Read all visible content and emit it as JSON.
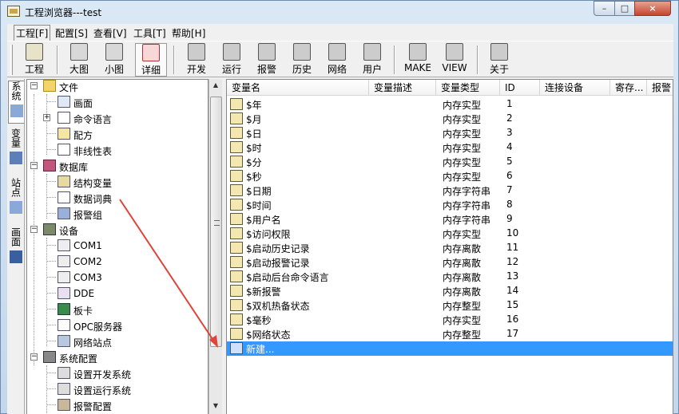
{
  "window": {
    "title": "工程浏览器---test",
    "min_glyph": "–",
    "max_glyph": "□",
    "close_glyph": "×"
  },
  "menu": [
    "工程[F]",
    "配置[S]",
    "查看[V]",
    "工具[T]",
    "帮助[H]"
  ],
  "toolbar": [
    "工程",
    "大图",
    "小图",
    "详细",
    "开发",
    "运行",
    "报警",
    "历史",
    "网络",
    "用户",
    "MAKE",
    "VIEW",
    "关于"
  ],
  "vtabs": [
    "系统",
    "变量",
    "站点",
    "画面"
  ],
  "tree": [
    {
      "label": "文件",
      "icon": "folder-icon"
    },
    {
      "label": "画面",
      "icon": "screen-icon"
    },
    {
      "label": "命令语言",
      "icon": "command-icon"
    },
    {
      "label": "配方",
      "icon": "recipe-icon"
    },
    {
      "label": "非线性表",
      "icon": "table-icon"
    },
    {
      "label": "数据库",
      "icon": "database-icon"
    },
    {
      "label": "结构变量",
      "icon": "struct-icon"
    },
    {
      "label": "数据词典",
      "icon": "dictionary-icon"
    },
    {
      "label": "报警组",
      "icon": "alarm-group-icon"
    },
    {
      "label": "设备",
      "icon": "device-icon"
    },
    {
      "label": "COM1",
      "icon": "com-port-icon"
    },
    {
      "label": "COM2",
      "icon": "com-port-icon"
    },
    {
      "label": "COM3",
      "icon": "com-port-icon"
    },
    {
      "label": "DDE",
      "icon": "dde-icon"
    },
    {
      "label": "板卡",
      "icon": "board-icon"
    },
    {
      "label": "OPC服务器",
      "icon": "opc-icon"
    },
    {
      "label": "网络站点",
      "icon": "network-station-icon"
    },
    {
      "label": "系统配置",
      "icon": "tools-icon"
    },
    {
      "label": "设置开发系统",
      "icon": "dev-settings-icon"
    },
    {
      "label": "设置运行系统",
      "icon": "run-settings-icon"
    },
    {
      "label": "报警配置",
      "icon": "alarm-config-icon"
    }
  ],
  "list": {
    "columns": [
      "变量名",
      "变量描述",
      "变量类型",
      "ID",
      "连接设备",
      "寄存...",
      "报警"
    ],
    "rows": [
      {
        "name": "$年",
        "type": "内存实型",
        "id": "1"
      },
      {
        "name": "$月",
        "type": "内存实型",
        "id": "2"
      },
      {
        "name": "$日",
        "type": "内存实型",
        "id": "3"
      },
      {
        "name": "$时",
        "type": "内存实型",
        "id": "4"
      },
      {
        "name": "$分",
        "type": "内存实型",
        "id": "5"
      },
      {
        "name": "$秒",
        "type": "内存实型",
        "id": "6"
      },
      {
        "name": "$日期",
        "type": "内存字符串",
        "id": "7"
      },
      {
        "name": "$时间",
        "type": "内存字符串",
        "id": "8"
      },
      {
        "name": "$用户名",
        "type": "内存字符串",
        "id": "9"
      },
      {
        "name": "$访问权限",
        "type": "内存实型",
        "id": "10"
      },
      {
        "name": "$启动历史记录",
        "type": "内存离散",
        "id": "11"
      },
      {
        "name": "$启动报警记录",
        "type": "内存离散",
        "id": "12"
      },
      {
        "name": "$启动后台命令语言",
        "type": "内存离散",
        "id": "13"
      },
      {
        "name": "$新报警",
        "type": "内存离散",
        "id": "14"
      },
      {
        "name": "$双机热备状态",
        "type": "内存整型",
        "id": "15"
      },
      {
        "name": "$毫秒",
        "type": "内存实型",
        "id": "16"
      },
      {
        "name": "$网络状态",
        "type": "内存整型",
        "id": "17"
      },
      {
        "name": "新建...",
        "type": "",
        "id": ""
      }
    ]
  },
  "colors": {
    "selection": "#3399ff",
    "arrow": "#e0443a"
  }
}
